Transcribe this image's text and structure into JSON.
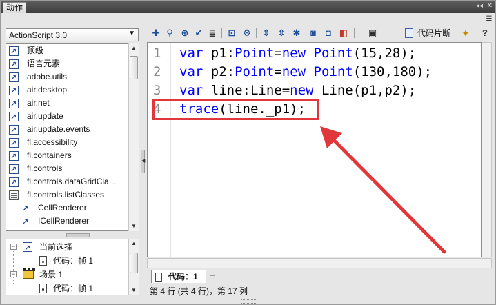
{
  "window": {
    "panel_tab": "动作",
    "collapse_glyph": "◂◂",
    "close_glyph": "✕",
    "menu_glyph": "☰"
  },
  "sidebar": {
    "language_select": "ActionScript 3.0",
    "items": [
      {
        "label": "顶级",
        "icon": "book-icon"
      },
      {
        "label": "语言元素",
        "icon": "book-icon"
      },
      {
        "label": "adobe.utils",
        "icon": "book-icon"
      },
      {
        "label": "air.desktop",
        "icon": "book-icon"
      },
      {
        "label": "air.net",
        "icon": "book-icon"
      },
      {
        "label": "air.update",
        "icon": "book-icon"
      },
      {
        "label": "air.update.events",
        "icon": "book-icon"
      },
      {
        "label": "fl.accessibility",
        "icon": "book-icon"
      },
      {
        "label": "fl.containers",
        "icon": "book-icon"
      },
      {
        "label": "fl.controls",
        "icon": "book-icon"
      },
      {
        "label": "fl.controls.dataGridCla...",
        "icon": "book-icon"
      },
      {
        "label": "fl.controls.listClasses",
        "icon": "book-open-icon"
      },
      {
        "label": "CellRenderer",
        "icon": "book-icon"
      },
      {
        "label": "ICellRenderer",
        "icon": "book-icon"
      }
    ]
  },
  "scene_tree": {
    "items": [
      {
        "expander": "⊟",
        "label": "当前选择"
      },
      {
        "label": "代码：帧 1"
      },
      {
        "expander": "⊟",
        "label": "场景 1"
      },
      {
        "label": "代码：帧 1"
      }
    ]
  },
  "toolbar": {
    "snippets_label": "代码片断",
    "help_label": "?"
  },
  "editor": {
    "lines": [
      {
        "number": "1",
        "tokens": [
          {
            "t": "var",
            "c": "kw"
          },
          {
            "t": " p1:",
            "c": "txt"
          },
          {
            "t": "Point",
            "c": "cls"
          },
          {
            "t": "=",
            "c": "txt"
          },
          {
            "t": "new",
            "c": "kw"
          },
          {
            "t": " ",
            "c": "txt"
          },
          {
            "t": "Point",
            "c": "cls"
          },
          {
            "t": "(15,28);",
            "c": "txt"
          }
        ]
      },
      {
        "number": "2",
        "tokens": [
          {
            "t": "var",
            "c": "kw"
          },
          {
            "t": " p2:",
            "c": "txt"
          },
          {
            "t": "Point",
            "c": "cls"
          },
          {
            "t": "=",
            "c": "txt"
          },
          {
            "t": "new",
            "c": "kw"
          },
          {
            "t": " ",
            "c": "txt"
          },
          {
            "t": "Point",
            "c": "cls"
          },
          {
            "t": "(130,180);",
            "c": "txt"
          }
        ]
      },
      {
        "number": "3",
        "tokens": [
          {
            "t": "var",
            "c": "kw"
          },
          {
            "t": " line:Line=",
            "c": "txt"
          },
          {
            "t": "new",
            "c": "kw"
          },
          {
            "t": " Line(p1,p2);",
            "c": "txt"
          }
        ]
      },
      {
        "number": "4",
        "tokens": [
          {
            "t": "trace",
            "c": "fn"
          },
          {
            "t": "(line._p1);",
            "c": "txt"
          }
        ]
      }
    ]
  },
  "bottom": {
    "code_tab": "代码：1",
    "status": "第 4 行 (共 4 行)，第 17 列"
  },
  "colors": {
    "keyword": "#0000ff",
    "highlight": "#e2373a"
  }
}
